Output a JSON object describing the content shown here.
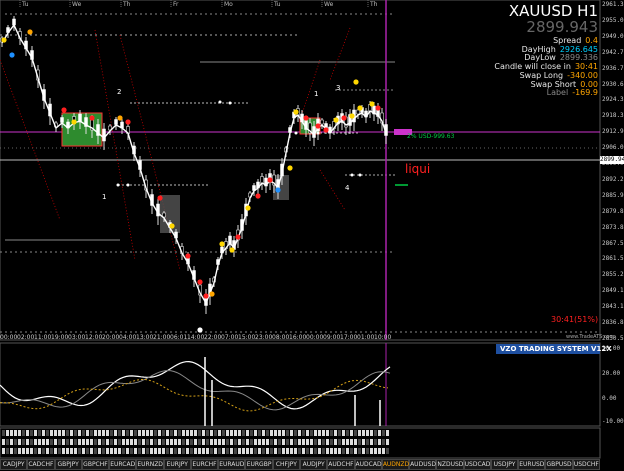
{
  "header": {
    "symbol": "XAUUSD H1",
    "price": "2899.943"
  },
  "info": [
    {
      "key": "Spread",
      "value": "0.4",
      "color": "orange"
    },
    {
      "key": "DayHigh",
      "value": "2926.645",
      "color": "cyan"
    },
    {
      "key": "DayLow",
      "value": "2899.336",
      "color": "gray"
    },
    {
      "key": "Candle will close in",
      "value": "30:41",
      "color": "orange"
    },
    {
      "key": "Swap Long",
      "value": "-340.00",
      "color": "orange"
    },
    {
      "key": "Swap Short",
      "value": "0.00",
      "color": "orange"
    },
    {
      "key": "Label",
      "value": "-169.9",
      "color": "orange",
      "key_gray": true
    }
  ],
  "day_labels": [
    "Tu",
    "We",
    "Th",
    "Fr",
    "Mo",
    "Tu",
    "We",
    "Th"
  ],
  "price_axis": [
    "2961.355",
    "2955.080",
    "2949.030",
    "2942.755",
    "2936.705",
    "2930.655",
    "2924.380",
    "2918.330",
    "2912.975",
    "2906.005",
    "2899.943",
    "2892.270",
    "2885.930",
    "2879.880",
    "2873.830",
    "2867.555",
    "2861.505",
    "2855.230",
    "2849.180",
    "2843.130",
    "2836.855",
    "2830.580"
  ],
  "time_axis": [
    "00:00",
    "02:00",
    "11:00",
    "19:00",
    "03:00",
    "12:00",
    "20:00",
    "04:00",
    "13:00",
    "21:00",
    "06:01",
    "14:00",
    "22:00",
    "07:00",
    "15:00",
    "23:00",
    "08:00",
    "16:00",
    "00:00",
    "09:00",
    "17:00",
    "01:00",
    "10:00"
  ],
  "annotations": {
    "center_note": "2% USD-999.63",
    "liqui": "liqui",
    "countdown": "30:41(51%)",
    "small_2": "2",
    "small_3": "3",
    "small_4": "4",
    "small_1": "1",
    "small_1b": "1",
    "watermark": "www.TradeATS.com"
  },
  "indicator": {
    "title": "VZO TRADING SYSTEM V12X",
    "axis": [
      "30.00",
      "20.00",
      "0.00",
      "-10.00"
    ]
  },
  "pairs": [
    "CADJPY",
    "CADCHF",
    "GBPJPY",
    "GBPCHF",
    "EURCAD",
    "EURNZD",
    "EURJPY",
    "EURCHF",
    "EURAUD",
    "EURGBP",
    "CHFJPY",
    "AUDJPY",
    "AUDCHF",
    "AUDCAD",
    "AUDNZD",
    "AUDUSD",
    "NZDUSD",
    "USDCAD",
    "USDJPY",
    "EURUSD",
    "GBPUSD",
    "USDCHF"
  ],
  "active_pair": "AUDNZD",
  "colors": {
    "background": "#000000",
    "bull": "#ffffff",
    "bear": "#ffffff",
    "magenta": "#cc33cc",
    "green_box": "#2e8b2e",
    "red": "#ff0000",
    "orange": "#ffa500",
    "indicator_title_bg": "#1e4fa0"
  }
}
